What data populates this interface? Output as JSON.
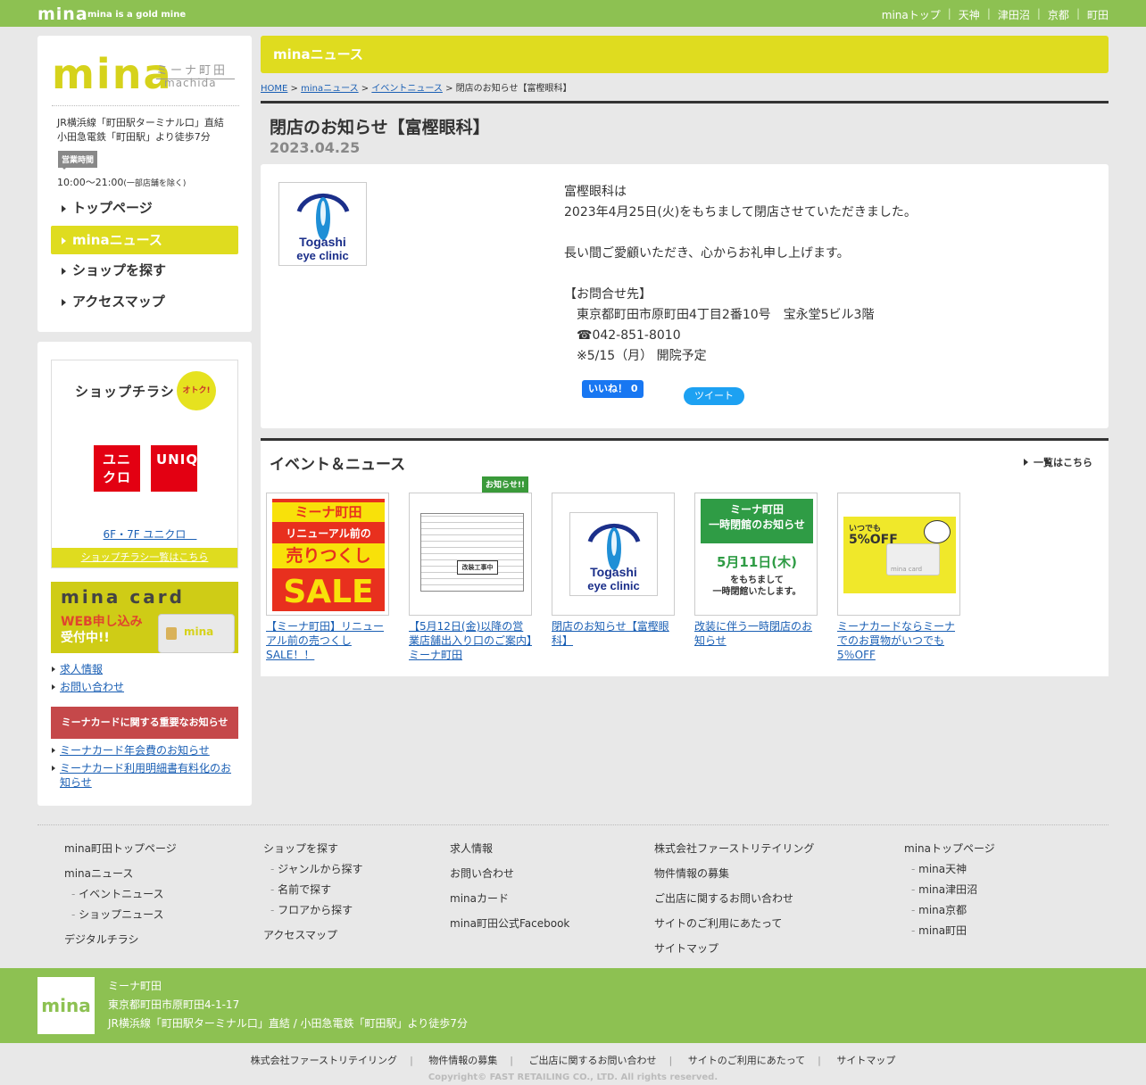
{
  "header": {
    "logo": "mina",
    "tagline": "mina is a gold mine",
    "nav": [
      "minaトップ",
      "天神",
      "津田沼",
      "京都",
      "町田"
    ]
  },
  "sidebar": {
    "logo_main": "mina",
    "logo_jp": "ミーナ町田",
    "logo_en": "machida",
    "access_line1": "JR横浜線「町田駅ターミナル口」直結",
    "access_line2": "小田急電鉄「町田駅」より徒歩7分",
    "hours_label": "営業時間",
    "hours": "10:00～21:00",
    "hours_note": "(一部店舗を除く)",
    "nav": [
      {
        "label": "トップページ"
      },
      {
        "label": "minaニュース"
      },
      {
        "label": "ショップを探す"
      },
      {
        "label": "アクセスマップ"
      }
    ],
    "flyer_title": "ショップチラシ",
    "flyer_badge": "オトク!",
    "flyer_logo1": "ユニクロ",
    "flyer_logo2": "UNIQLO",
    "flyer_link": "6F・7F ユニクロ　",
    "flyer_all": "ショップチラシ一覧はこちら",
    "card_title": "mina card",
    "card_web1": "WEB申し込み",
    "card_web2": "受付中!!",
    "card_img_text": "mina",
    "links": [
      "求人情報",
      "お問い合わせ"
    ],
    "notice": "ミーナカードに関する重要なお知らせ",
    "notice_links": [
      "ミーナカード年会費のお知らせ",
      "ミーナカード利用明細書有料化のお知らせ"
    ]
  },
  "main": {
    "section_bar": "minaニュース",
    "breadcrumb": {
      "home": "HOME",
      "news": "minaニュース",
      "event": "イベントニュース",
      "current": "閉店のお知らせ【富樫眼科】",
      "sep": ">"
    },
    "title": "閉店のお知らせ【富樫眼科】",
    "date": "2023.04.25",
    "logo_line1": "Togashi",
    "logo_line2": "eye clinic",
    "body": [
      "富樫眼科は",
      "2023年4月25日(火)をもちまして閉店させていただきました。",
      "",
      "長い間ご愛顧いただき、心からお礼申し上げます。",
      "",
      "【お問合せ先】",
      "　東京都町田市原町田4丁目2番10号　宝永堂5ビル3階",
      "　☎042-851-8010",
      "　※5/15（月） 開院予定"
    ],
    "like": "いいね！ 0",
    "tweet": "ツイート"
  },
  "events": {
    "title": "イベント＆ニュース",
    "all": "一覧はこちら",
    "badge": "お知らせ!!",
    "items": [
      {
        "caption": "【ミーナ町田】リニューアル前の売つくしSALE！！",
        "img1": "ミーナ町田",
        "img2": "リニューアル前の",
        "img3": "売りつくし",
        "img4": "SALE"
      },
      {
        "caption": "【5月12日(金)以降の営業店舗出入り口のご案内】ミーナ町田",
        "img1": "改装工事中"
      },
      {
        "caption": "閉店のお知らせ【富樫眼科】",
        "img1": "Togashi",
        "img2": "eye clinic"
      },
      {
        "caption": "改装に伴う一時閉店のお知らせ",
        "img1": "ミーナ町田",
        "img2": "一時閉館のお知らせ",
        "img3": "5月11日(木)",
        "img4": "をもちまして",
        "img5": "一時閉館いたします。"
      },
      {
        "caption": "ミーナカードならミーナでのお買物がいつでも5％OFF",
        "img1": "いつでも",
        "img2": "5%OFF",
        "img3": "mina card"
      }
    ]
  },
  "footer": {
    "col1": [
      "mina町田トップページ",
      "minaニュース",
      "イベントニュース",
      "ショップニュース",
      "デジタルチラシ"
    ],
    "col2": [
      "ショップを探す",
      "ジャンルから探す",
      "名前で探す",
      "フロアから探す",
      "アクセスマップ"
    ],
    "col3": [
      "求人情報",
      "お問い合わせ",
      "minaカード",
      "mina町田公式Facebook"
    ],
    "col4": [
      "株式会社ファーストリテイリング",
      "物件情報の募集",
      "ご出店に関するお問い合わせ",
      "サイトのご利用にあたって",
      "サイトマップ"
    ],
    "col5": [
      "minaトップページ",
      "mina天神",
      "mina津田沼",
      "mina京都",
      "mina町田"
    ],
    "logo": "mina",
    "name": "ミーナ町田",
    "address": "東京都町田市原町田4-1-17",
    "access": "JR横浜線「町田駅ターミナル口」直結 / 小田急電鉄「町田駅」より徒歩7分",
    "bottom_links": [
      "株式会社ファーストリテイリング",
      "物件情報の募集",
      "ご出店に関するお問い合わせ",
      "サイトのご利用にあたって",
      "サイトマップ"
    ],
    "copyright": "Copyright© FAST RETAILING CO., LTD. All rights reserved."
  },
  "colors": {
    "green": "#8dc152",
    "yellow": "#dfdc1f",
    "red": "#c5484a"
  }
}
